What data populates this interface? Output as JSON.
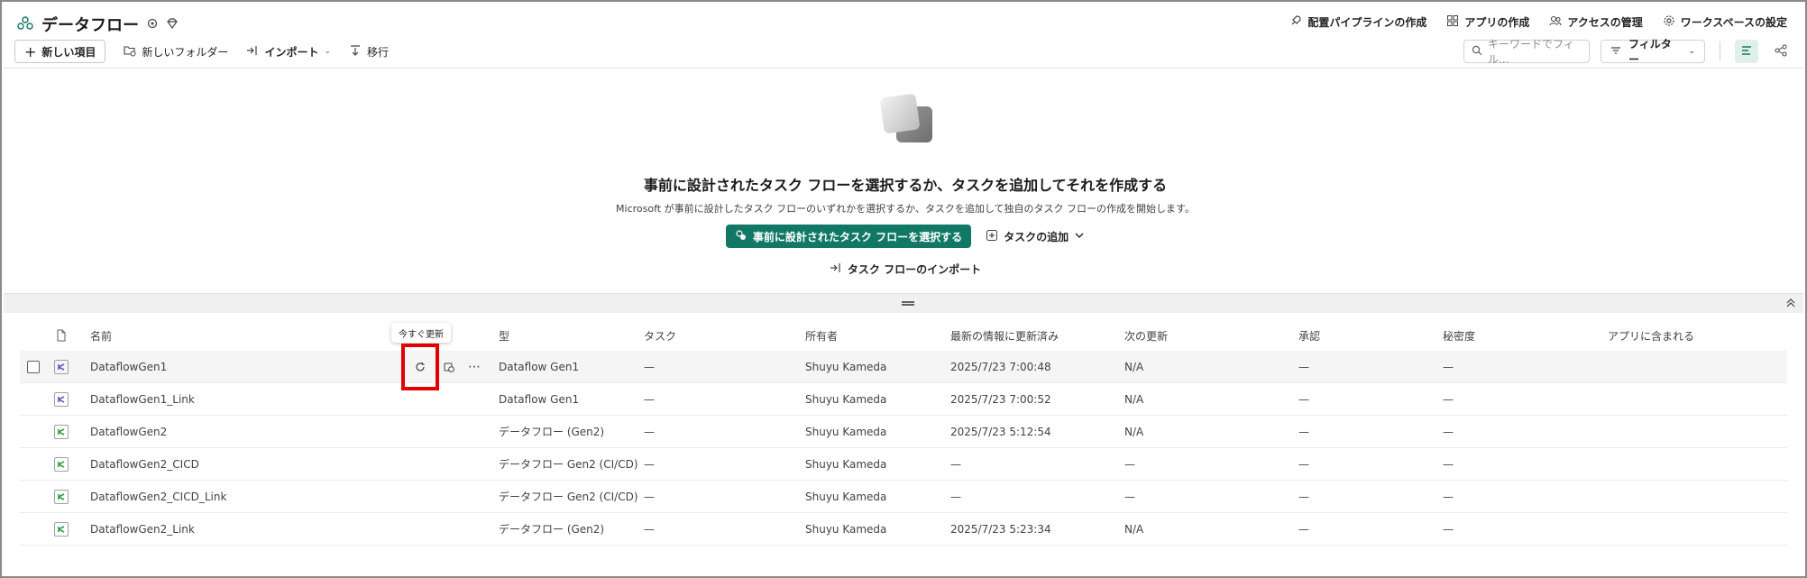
{
  "header": {
    "title": "データフロー",
    "links": [
      {
        "label": "配置パイプラインの作成",
        "icon": "rocket-icon"
      },
      {
        "label": "アプリの作成",
        "icon": "app-grid-icon"
      },
      {
        "label": "アクセスの管理",
        "icon": "people-icon"
      },
      {
        "label": "ワークスペースの設定",
        "icon": "gear-icon"
      }
    ]
  },
  "toolbar": {
    "new_item": "新しい項目",
    "new_folder": "新しいフォルダー",
    "import": "インポート",
    "migrate": "移行",
    "search_placeholder": "キーワードでフィル...",
    "filter": "フィルター"
  },
  "hero": {
    "title": "事前に設計されたタスク フローを選択するか、タスクを追加してそれを作成する",
    "subtitle": "Microsoft が事前に設計したタスク フローのいずれかを選択するか、タスクを追加して独自のタスク フローの作成を開始します。",
    "primary_button": "事前に設計されたタスク フローを選択する",
    "add_task": "タスクの追加",
    "import_link": "タスク フローのインポート"
  },
  "table": {
    "columns": {
      "name": "名前",
      "type": "型",
      "task": "タスク",
      "owner": "所有者",
      "refreshed": "最新の情報に更新済み",
      "next_refresh": "次の更新",
      "endorsement": "承認",
      "sensitivity": "秘密度",
      "in_app": "アプリに含まれる"
    },
    "tooltip": "今すぐ更新",
    "rows": [
      {
        "name": "DataflowGen1",
        "type": "Dataflow Gen1",
        "task": "—",
        "owner": "Shuyu Kameda",
        "refreshed": "2025/7/23 7:00:48",
        "next": "N/A",
        "endorsement": "—",
        "sensitivity": "—",
        "icon_color": "#7c4dbd"
      },
      {
        "name": "DataflowGen1_Link",
        "type": "Dataflow Gen1",
        "task": "—",
        "owner": "Shuyu Kameda",
        "refreshed": "2025/7/23 7:00:52",
        "next": "N/A",
        "endorsement": "—",
        "sensitivity": "—",
        "icon_color": "#7c4dbd"
      },
      {
        "name": "DataflowGen2",
        "type": "データフロー (Gen2)",
        "task": "—",
        "owner": "Shuyu Kameda",
        "refreshed": "2025/7/23 5:12:54",
        "next": "N/A",
        "endorsement": "—",
        "sensitivity": "—",
        "icon_color": "#2e9e48"
      },
      {
        "name": "DataflowGen2_CICD",
        "type": "データフロー Gen2 (CI/CD)",
        "task": "—",
        "owner": "Shuyu Kameda",
        "refreshed": "—",
        "next": "—",
        "endorsement": "—",
        "sensitivity": "—",
        "icon_color": "#2e9e48"
      },
      {
        "name": "DataflowGen2_CICD_Link",
        "type": "データフロー Gen2 (CI/CD)",
        "task": "—",
        "owner": "Shuyu Kameda",
        "refreshed": "—",
        "next": "—",
        "endorsement": "—",
        "sensitivity": "—",
        "icon_color": "#2e9e48"
      },
      {
        "name": "DataflowGen2_Link",
        "type": "データフロー (Gen2)",
        "task": "—",
        "owner": "Shuyu Kameda",
        "refreshed": "2025/7/23 5:23:34",
        "next": "N/A",
        "endorsement": "—",
        "sensitivity": "—",
        "icon_color": "#2e9e48"
      }
    ]
  },
  "colors": {
    "accent": "#117865",
    "highlight": "#e30000"
  }
}
